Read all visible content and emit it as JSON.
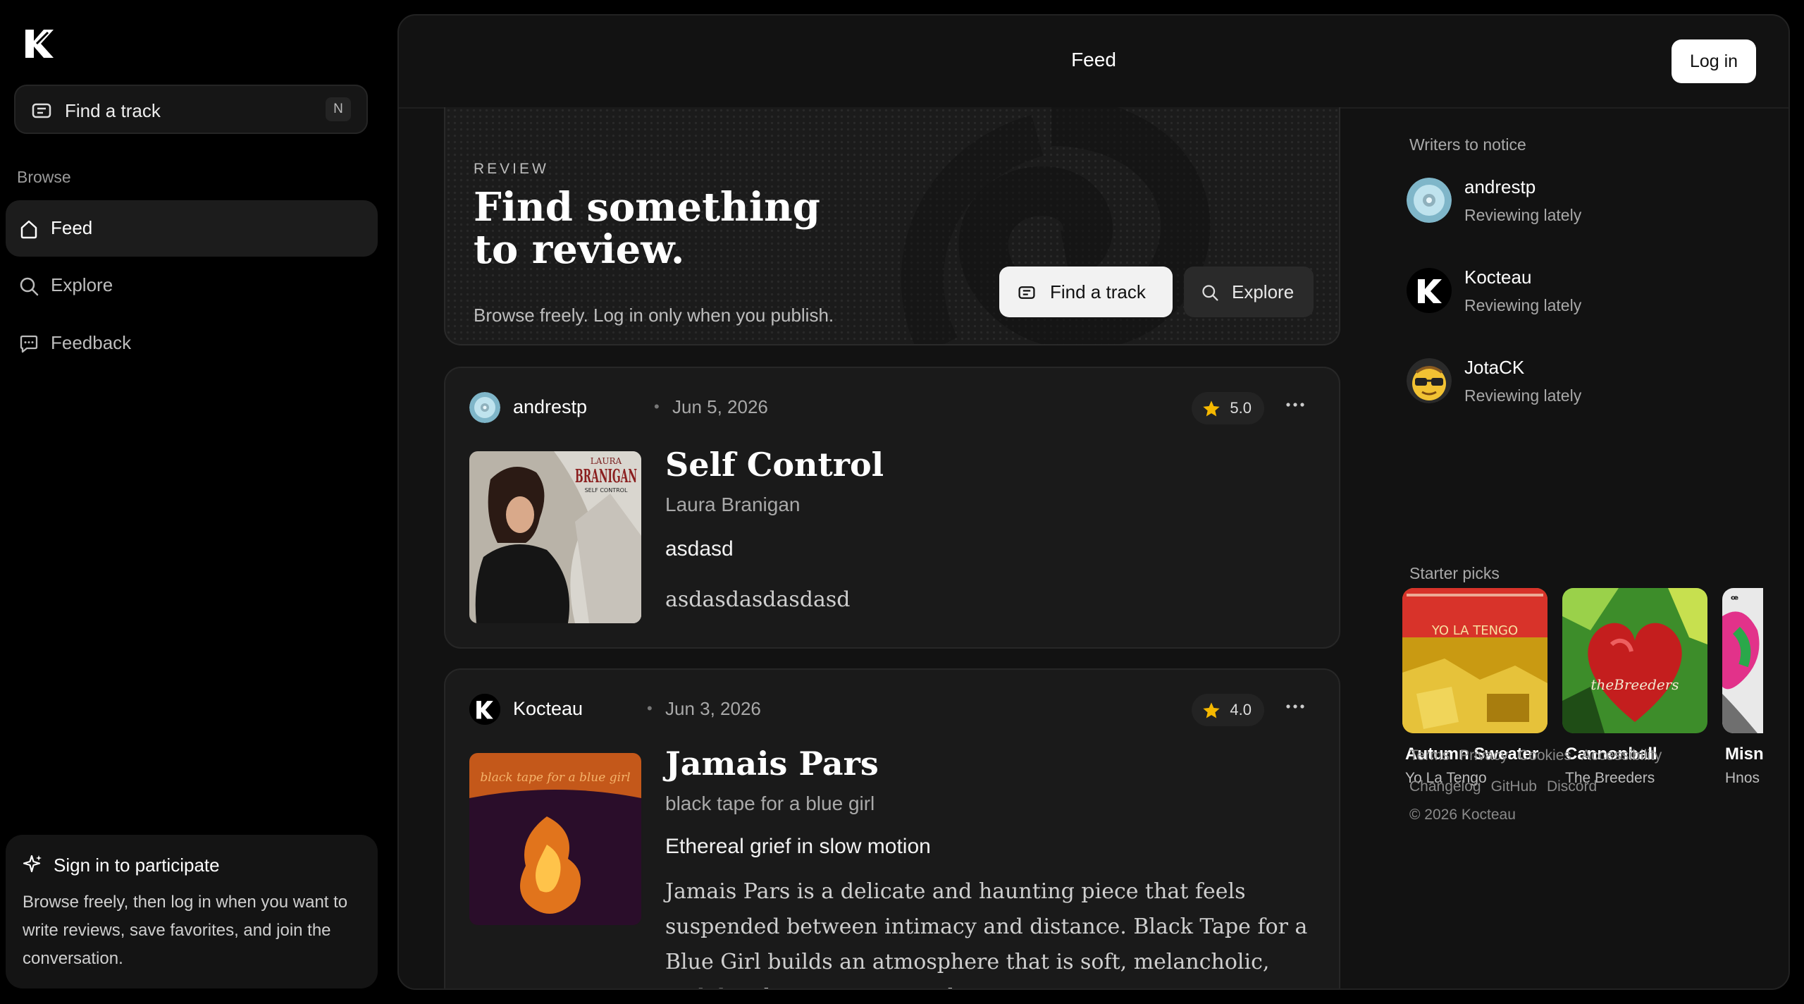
{
  "sidebar": {
    "find_label": "Find a track",
    "find_shortcut": "N",
    "browse_heading": "Browse",
    "nav": [
      {
        "label": "Feed",
        "icon": "home-icon",
        "active": true
      },
      {
        "label": "Explore",
        "icon": "search-icon",
        "active": false
      },
      {
        "label": "Feedback",
        "icon": "message-icon",
        "active": false
      }
    ],
    "signin": {
      "title": "Sign in to participate",
      "text": "Browse freely, then log in when you want to write reviews, save favorites, and join the conversation."
    }
  },
  "header": {
    "title": "Feed",
    "login_label": "Log in"
  },
  "hero": {
    "kicker": "REVIEW",
    "title_line1": "Find something",
    "title_line2": "to review.",
    "subtitle": "Browse freely. Log in only when you publish.",
    "find_button": "Find a track",
    "explore_button": "Explore"
  },
  "reviews": [
    {
      "user": "andrestp",
      "date": "Jun 5, 2026",
      "rating": "5.0",
      "title": "Self Control",
      "artist": "Laura Branigan",
      "headline": "asdasd",
      "body": "asdasdasdasdasd",
      "cover_text_1": "LAURA",
      "cover_text_2": "BRANIGAN",
      "cover_text_3": "SELF CONTROL"
    },
    {
      "user": "Kocteau",
      "date": "Jun 3, 2026",
      "rating": "4.0",
      "title": "Jamais Pars",
      "artist": "black tape for a blue girl",
      "headline": "Ethereal grief in slow motion",
      "body": "Jamais Pars is a delicate and haunting piece that feels suspended between intimacy and distance. Black Tape for a Blue Girl builds an atmosphere that is soft, melancholic, and deeply immersive, with a",
      "cover_text_1": "black tape for a blue girl"
    }
  ],
  "right": {
    "writers_heading": "Writers to notice",
    "writers": [
      {
        "name": "andrestp",
        "status": "Reviewing lately"
      },
      {
        "name": "Kocteau",
        "status": "Reviewing lately"
      },
      {
        "name": "JotaCK",
        "status": "Reviewing lately"
      }
    ],
    "picks_heading": "Starter picks",
    "picks": [
      {
        "title": "Autumn Sweater",
        "artist": "Yo La Tengo",
        "cover_text": "YO LA TENGO"
      },
      {
        "title": "Cannonball",
        "artist": "The Breeders",
        "cover_text": "theBreeders"
      },
      {
        "title": "Misn",
        "artist": "Hnos"
      }
    ],
    "footer_row1": [
      "Terms",
      "Privacy",
      "Cookies",
      "Accessibility"
    ],
    "footer_row2": [
      "Changelog",
      "GitHub",
      "Discord"
    ],
    "copyright": "© 2026 Kocteau"
  },
  "colors": {
    "background": "#000000",
    "panel": "#121212",
    "card": "#1a1a1a",
    "star": "#f5b800"
  }
}
